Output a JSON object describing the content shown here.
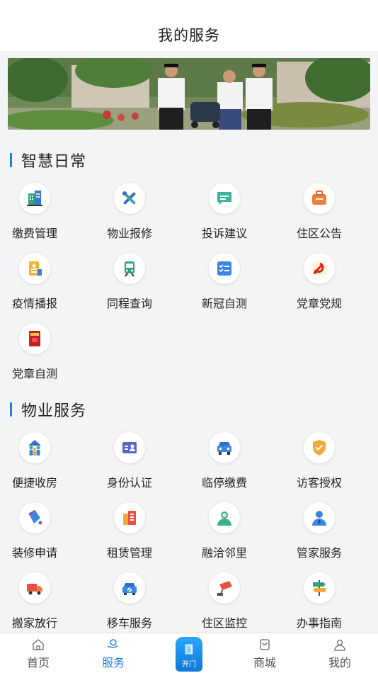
{
  "header": {
    "title": "我的服务"
  },
  "sections": [
    {
      "title": "智慧日常",
      "items": [
        {
          "label": "缴费管理",
          "icon": "building-icon"
        },
        {
          "label": "物业报修",
          "icon": "wrench-screwdriver-icon"
        },
        {
          "label": "投诉建议",
          "icon": "chat-bubble-icon"
        },
        {
          "label": "住区公告",
          "icon": "notice-bag-icon"
        },
        {
          "label": "疫情播报",
          "icon": "health-report-icon"
        },
        {
          "label": "同程查询",
          "icon": "train-icon"
        },
        {
          "label": "新冠自测",
          "icon": "checklist-icon"
        },
        {
          "label": "党章党规",
          "icon": "party-emblem-icon"
        },
        {
          "label": "党章自测",
          "icon": "party-book-icon"
        }
      ]
    },
    {
      "title": "物业服务",
      "items": [
        {
          "label": "便捷收房",
          "icon": "house-people-icon"
        },
        {
          "label": "身份认证",
          "icon": "id-card-icon"
        },
        {
          "label": "临停缴费",
          "icon": "car-front-icon"
        },
        {
          "label": "访客授权",
          "icon": "shield-check-icon"
        },
        {
          "label": "装修申请",
          "icon": "paint-bucket-icon"
        },
        {
          "label": "租赁管理",
          "icon": "rental-docs-icon"
        },
        {
          "label": "融洽邻里",
          "icon": "neighbor-user-icon"
        },
        {
          "label": "管家服务",
          "icon": "butler-icon"
        },
        {
          "label": "搬家放行",
          "icon": "truck-icon"
        },
        {
          "label": "移车服务",
          "icon": "move-car-icon"
        },
        {
          "label": "住区监控",
          "icon": "camera-icon"
        },
        {
          "label": "办事指南",
          "icon": "signpost-icon"
        }
      ]
    }
  ],
  "tabbar": {
    "tabs": [
      {
        "label": "首页",
        "icon": "home-icon"
      },
      {
        "label": "服务",
        "icon": "service-hand-icon"
      },
      {
        "label": "商城",
        "icon": "shopping-bag-icon"
      },
      {
        "label": "我的",
        "icon": "user-icon"
      }
    ],
    "open_label": "开门",
    "active_color": "#1f7ee6"
  }
}
